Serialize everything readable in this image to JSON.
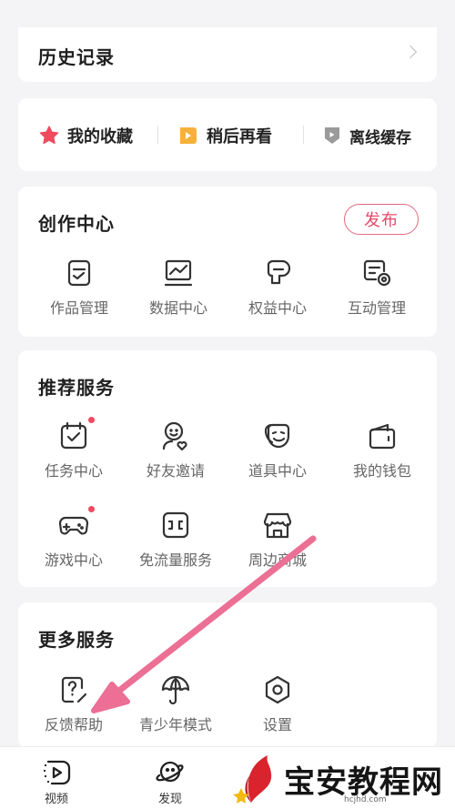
{
  "history": {
    "title": "历史记录"
  },
  "quick_actions": [
    {
      "label": "我的收藏",
      "icon": "star-icon"
    },
    {
      "label": "稍后再看",
      "icon": "play-later-icon"
    },
    {
      "label": "离线缓存",
      "icon": "offline-download-icon"
    }
  ],
  "creator_center": {
    "title": "创作中心",
    "publish_label": "发布",
    "items": [
      {
        "label": "作品管理",
        "icon": "works-manage-icon"
      },
      {
        "label": "数据中心",
        "icon": "data-chart-icon"
      },
      {
        "label": "权益中心",
        "icon": "rights-icon"
      },
      {
        "label": "互动管理",
        "icon": "interaction-manage-icon"
      }
    ]
  },
  "recommended_services": {
    "title": "推荐服务",
    "items": [
      {
        "label": "任务中心",
        "icon": "task-calendar-icon",
        "dot": true
      },
      {
        "label": "好友邀请",
        "icon": "friend-invite-icon",
        "dot": false
      },
      {
        "label": "道具中心",
        "icon": "props-mask-icon",
        "dot": false
      },
      {
        "label": "我的钱包",
        "icon": "wallet-icon",
        "dot": false
      },
      {
        "label": "游戏中心",
        "icon": "gamepad-icon",
        "dot": true
      },
      {
        "label": "免流量服务",
        "icon": "free-data-icon",
        "dot": false
      },
      {
        "label": "周边商城",
        "icon": "store-icon",
        "dot": false
      }
    ]
  },
  "more_services": {
    "title": "更多服务",
    "items": [
      {
        "label": "反馈帮助",
        "icon": "feedback-help-icon"
      },
      {
        "label": "青少年模式",
        "icon": "umbrella-icon"
      },
      {
        "label": "设置",
        "icon": "settings-icon"
      }
    ]
  },
  "bottom_nav": [
    {
      "label": "视频",
      "icon": "video-tab-icon"
    },
    {
      "label": "发现",
      "icon": "discover-planet-icon"
    }
  ],
  "watermark": {
    "text": "宝安教程网",
    "url": "hcjhd.com"
  },
  "colors": {
    "accent": "#e5486a",
    "arrow": "#ec6f95",
    "star": "#ef4a5e",
    "later": "#f6b13a",
    "background": "#f4f4f6"
  }
}
